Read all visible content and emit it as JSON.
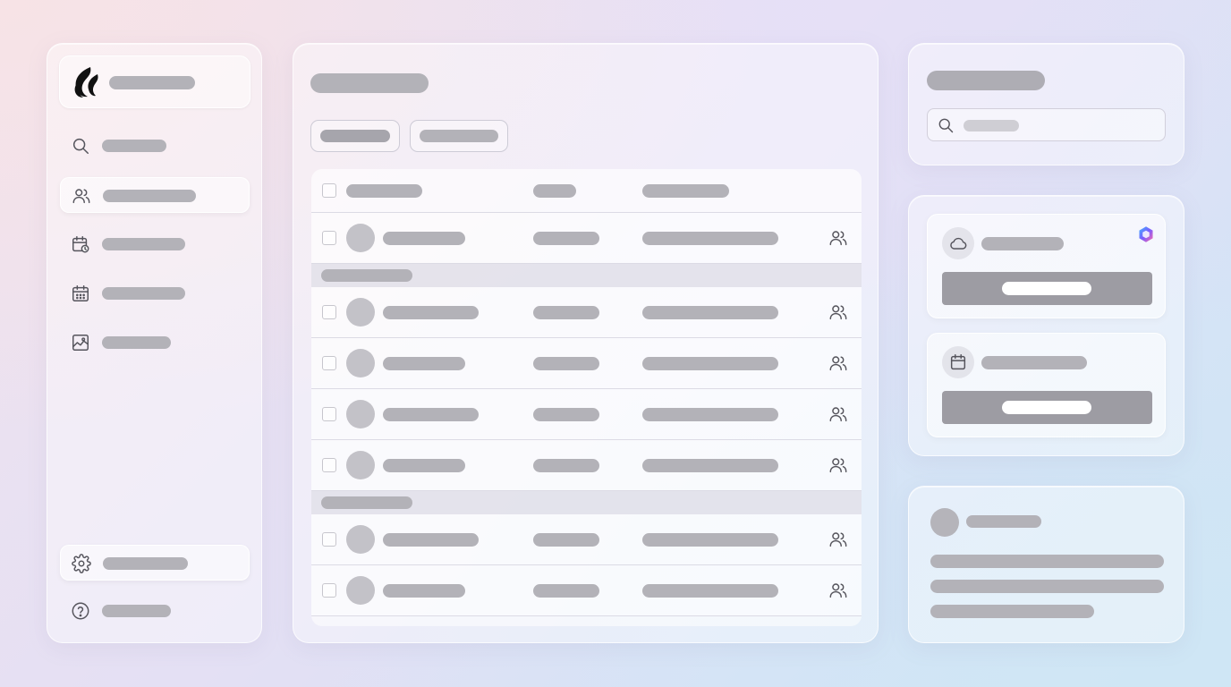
{
  "sidebar": {
    "brand": {
      "icon": "flame-logo-icon"
    },
    "items": [
      {
        "icon": "search-icon",
        "active": false
      },
      {
        "icon": "users-icon",
        "active": true
      },
      {
        "icon": "calendar-clock-icon",
        "active": false
      },
      {
        "icon": "calendar-icon",
        "active": false
      },
      {
        "icon": "chart-image-icon",
        "active": false
      }
    ],
    "footer_items": [
      {
        "icon": "gear-icon",
        "active": true
      },
      {
        "icon": "help-circle-icon",
        "active": false
      }
    ]
  },
  "main": {
    "filters_count": 2,
    "table": {
      "groups": [
        {
          "rows": 1
        },
        {
          "rows": 4
        },
        {
          "rows": 2
        }
      ],
      "row_icon": "users-icon"
    }
  },
  "search_panel": {
    "icon": "search-icon"
  },
  "integrations": [
    {
      "icon": "cloud-icon",
      "brand_mark": "copilot-logo-icon"
    },
    {
      "icon": "calendar-icon"
    }
  ],
  "profile": {
    "avatar": "avatar"
  },
  "colors": {
    "skeleton": "#b3b2b8",
    "action_button": "#9d9ca3",
    "text_icon": "#55545c"
  }
}
